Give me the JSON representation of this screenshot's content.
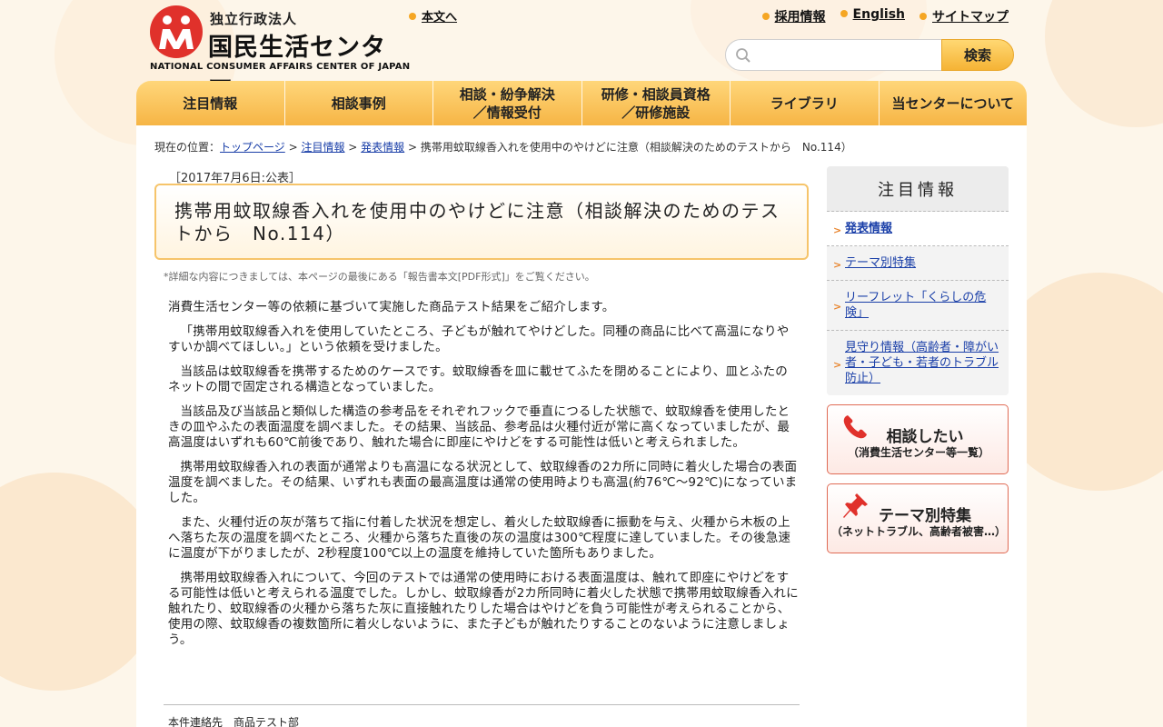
{
  "header": {
    "logo": {
      "sub": "独立行政法人",
      "main": "国民生活センター",
      "en": "NATIONAL CONSUMER AFFAIRS CENTER OF JAPAN"
    },
    "skip_link": "本文へ",
    "util_links": [
      "採用情報",
      "English",
      "サイトマップ"
    ],
    "search": {
      "placeholder": "",
      "button": "検索"
    }
  },
  "nav": {
    "items": [
      "注目情報",
      "相談事例",
      "相談・紛争解決\n／情報受付",
      "研修・相談員資格\n／研修施設",
      "ライブラリ",
      "当センターについて"
    ]
  },
  "breadcrumb": {
    "prefix": "現在の位置：",
    "links": [
      "トップページ",
      "注目情報",
      "発表情報"
    ],
    "current": "携帯用蚊取線香入れを使用中のやけどに注意（相談解決のためのテストから　No.114）",
    "sep": " > "
  },
  "article": {
    "date": "［2017年7月6日:公表］",
    "title": "携帯用蚊取線香入れを使用中のやけどに注意（相談解決のためのテストから　No.114）",
    "note": "*詳細な内容につきましては、本ページの最後にある「報告書本文[PDF形式]」をご覧ください。",
    "paragraphs": [
      "消費生活センター等の依頼に基づいて実施した商品テスト結果をご紹介します。",
      "「携帯用蚊取線香入れを使用していたところ、子どもが触れてやけどした。同種の商品に比べて高温になりやすいか調べてほしい。」という依頼を受けました。",
      "当該品は蚊取線香を携帯するためのケースです。蚊取線香を皿に載せてふたを閉めることにより、皿とふたのネットの間で固定される構造となっていました。",
      "当該品及び当該品と類似した構造の参考品をそれぞれフックで垂直につるした状態で、蚊取線香を使用したときの皿やふたの表面温度を調べました。その結果、当該品、参考品は火種付近が常に高くなっていましたが、最高温度はいずれも60℃前後であり、触れた場合に即座にやけどをする可能性は低いと考えられました。",
      "携帯用蚊取線香入れの表面が通常よりも高温になる状況として、蚊取線香の2カ所に同時に着火した場合の表面温度を調べました。その結果、いずれも表面の最高温度は通常の使用時よりも高温(約76℃～92℃)になっていました。",
      "また、火種付近の灰が落ちて指に付着した状況を想定し、着火した蚊取線香に振動を与え、火種から木板の上へ落ちた灰の温度を調べたところ、火種から落ちた直後の灰の温度は300℃程度に達していました。その後急速に温度が下がりましたが、2秒程度100℃以上の温度を維持していた箇所もありました。",
      "携帯用蚊取線香入れについて、今回のテストでは通常の使用時における表面温度は、触れて即座にやけどをする可能性は低いと考えられる温度でした。しかし、蚊取線香が2カ所同時に着火した状態で携帯用蚊取線香入れに触れたり、蚊取線香の火種から落ちた灰に直接触れたりした場合はやけどを負う可能性が考えられることから、使用の際、蚊取線香の複数箇所に着火しないように、また子どもが触れたりすることのないように注意しましょう。"
    ],
    "contact": "本件連絡先　商品テスト部"
  },
  "sidebar": {
    "title": "注目情報",
    "items": [
      "発表情報",
      "テーマ別特集",
      "リーフレット「くらしの危険」",
      "見守り情報（高齢者・障がい者・子ども・若者のトラブル防止）"
    ],
    "banners": [
      {
        "title": "相談したい",
        "sub": "（消費生活センター等一覧）",
        "icon": "phone-icon"
      },
      {
        "title": "テーマ別特集",
        "sub": "（ネットトラブル、高齢者被害…）",
        "icon": "pushpin-icon"
      }
    ]
  },
  "colors": {
    "accent": "#f6b545",
    "logo_red": "#e0312b",
    "link": "#1a3fa8",
    "arrow": "#e8842c",
    "banner_border": "#e06b55"
  }
}
